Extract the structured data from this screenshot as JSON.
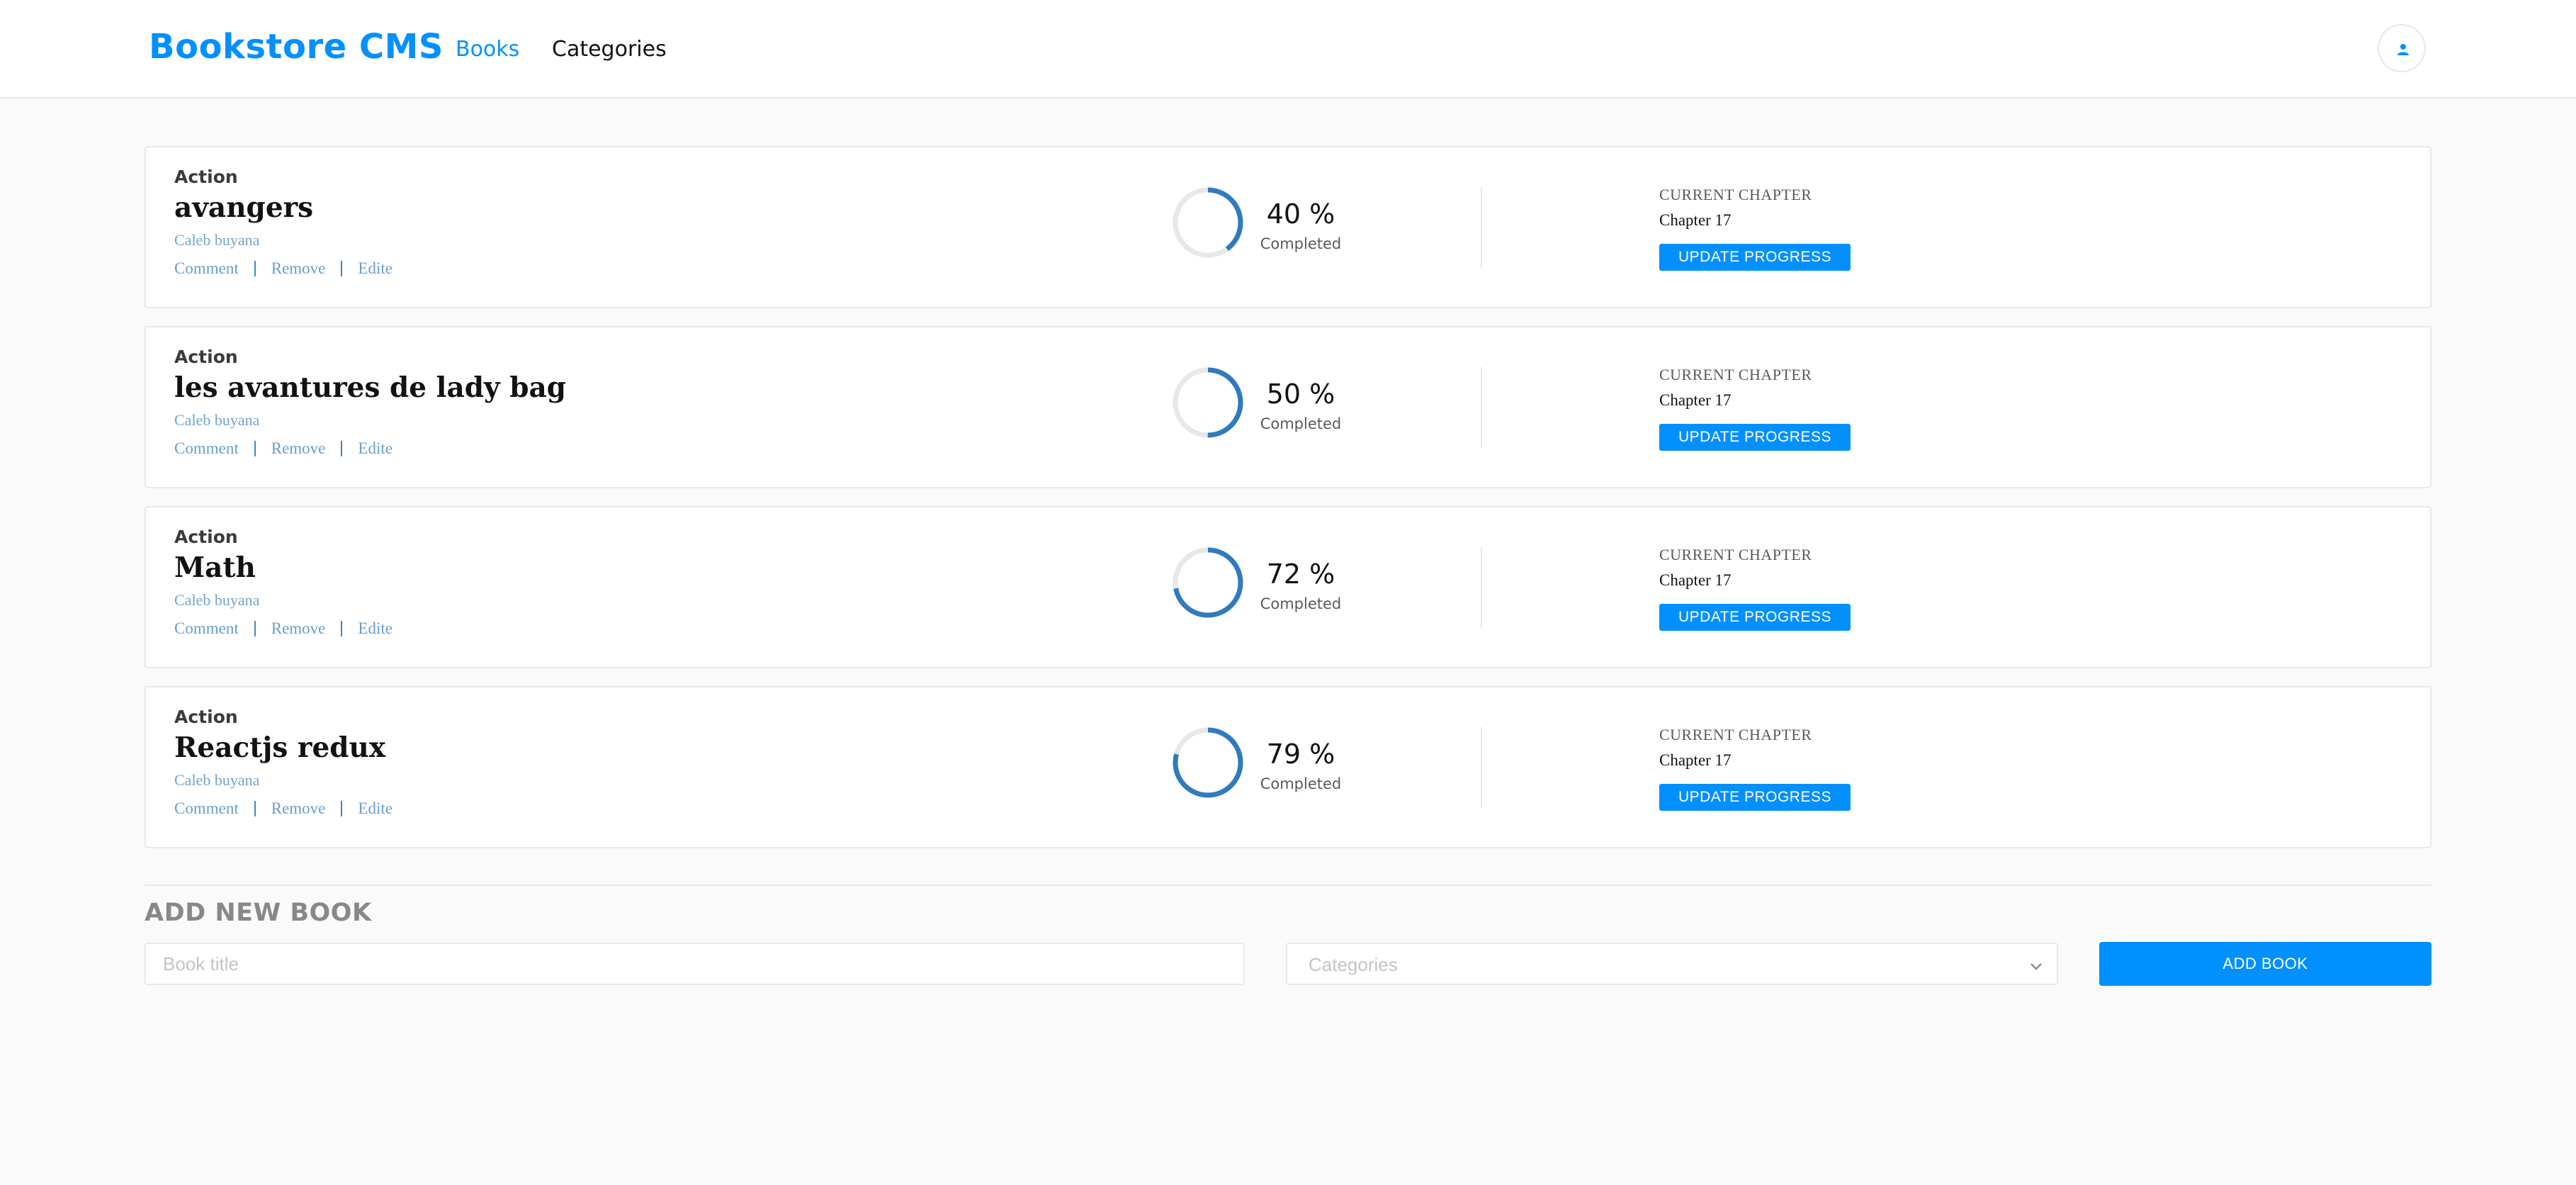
{
  "header": {
    "brand": "Bookstore CMS",
    "nav": [
      {
        "label": "Books",
        "active": true
      },
      {
        "label": "Categories",
        "active": false
      }
    ],
    "avatar_icon": "user-icon"
  },
  "books": [
    {
      "genre": "Action",
      "title": "avangers",
      "author": "Caleb buyana",
      "actions": [
        "Comment",
        "Remove",
        "Edite"
      ],
      "progress": 40,
      "progress_text": "40 %",
      "completed_label": "Completed",
      "chapter_heading": "CURRENT CHAPTER",
      "chapter": "Chapter 17",
      "update_label": "UPDATE PROGRESS"
    },
    {
      "genre": "Action",
      "title": "les avantures de lady bag",
      "author": "Caleb buyana",
      "actions": [
        "Comment",
        "Remove",
        "Edite"
      ],
      "progress": 50,
      "progress_text": "50 %",
      "completed_label": "Completed",
      "chapter_heading": "CURRENT CHAPTER",
      "chapter": "Chapter 17",
      "update_label": "UPDATE PROGRESS"
    },
    {
      "genre": "Action",
      "title": "Math",
      "author": "Caleb buyana",
      "actions": [
        "Comment",
        "Remove",
        "Edite"
      ],
      "progress": 72,
      "progress_text": "72 %",
      "completed_label": "Completed",
      "chapter_heading": "CURRENT CHAPTER",
      "chapter": "Chapter 17",
      "update_label": "UPDATE PROGRESS"
    },
    {
      "genre": "Action",
      "title": "Reactjs redux",
      "author": "Caleb buyana",
      "actions": [
        "Comment",
        "Remove",
        "Edite"
      ],
      "progress": 79,
      "progress_text": "79 %",
      "completed_label": "Completed",
      "chapter_heading": "CURRENT CHAPTER",
      "chapter": "Chapter 17",
      "update_label": "UPDATE PROGRESS"
    }
  ],
  "form": {
    "heading": "ADD NEW BOOK",
    "title_placeholder": "Book title",
    "title_value": "",
    "category_placeholder": "Categories",
    "category_icon": "chevron-down-icon",
    "submit_label": "ADD BOOK"
  },
  "colors": {
    "primary": "#0290ff",
    "progress_arc": "#307bbe",
    "progress_track": "#e8e8e8",
    "background": "#fafafa",
    "card_border": "#e8e8e8",
    "link": "#4386bf"
  }
}
